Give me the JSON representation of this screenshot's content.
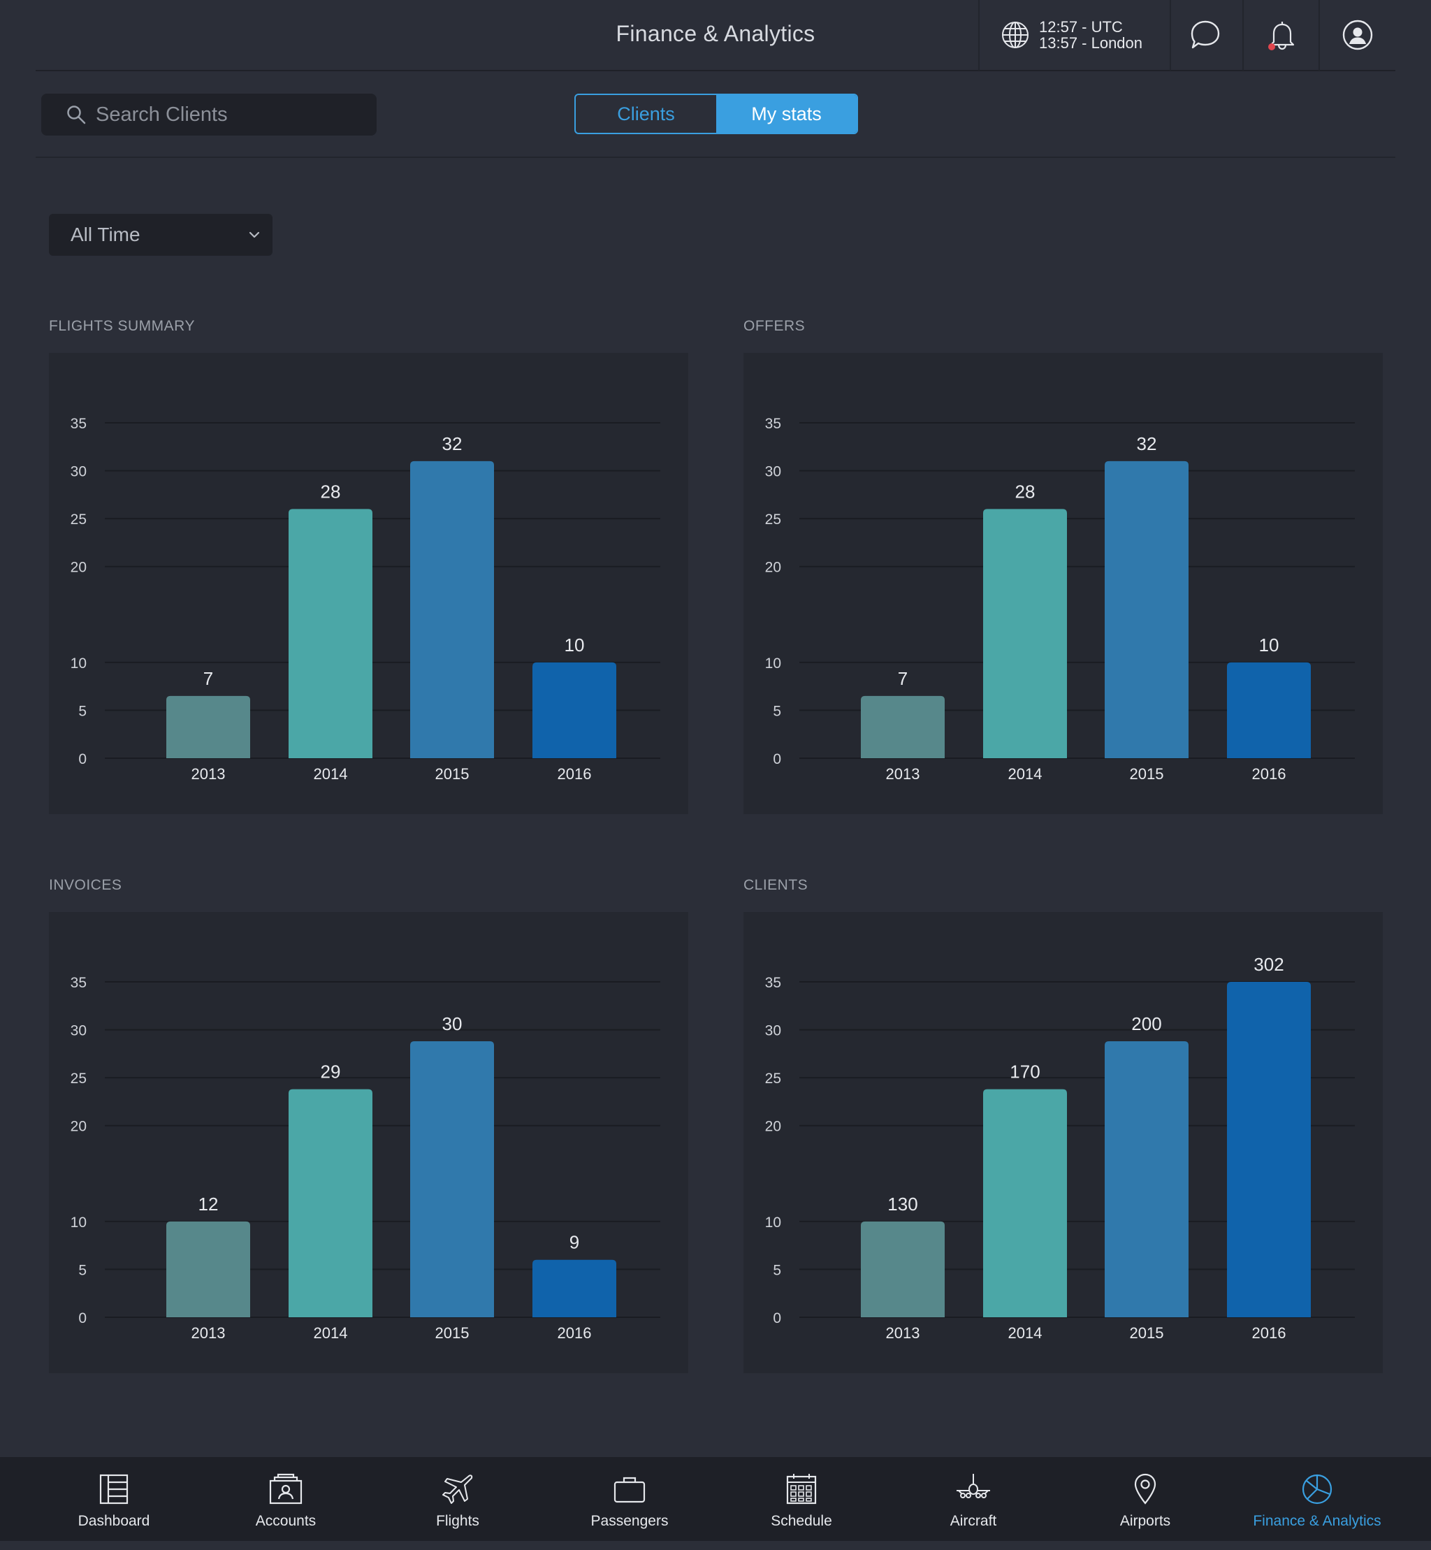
{
  "header": {
    "title": "Finance & Analytics",
    "time_utc": "12:57 - UTC",
    "time_local": "13:57 - London"
  },
  "search": {
    "placeholder": "Search Clients"
  },
  "tabs": [
    {
      "label": "Clients",
      "active": false
    },
    {
      "label": "My stats",
      "active": true
    }
  ],
  "filter": {
    "selected": "All Time"
  },
  "colors": {
    "accent": "#3a9fe0",
    "bar_2013": "#57888b",
    "bar_2014": "#4ba7a7",
    "bar_2015": "#3079ac",
    "bar_2016": "#1063ab",
    "notification_dot": "#e0464e"
  },
  "chart_data": [
    {
      "type": "bar",
      "title": "FLIGHTS SUMMARY",
      "categories": [
        "2013",
        "2014",
        "2015",
        "2016"
      ],
      "values": [
        7,
        28,
        32,
        10
      ],
      "bar_heights": [
        6.5,
        26,
        31,
        10
      ],
      "data_labels": [
        "7",
        "28",
        "32",
        "10"
      ],
      "yticks": [
        "0",
        "5",
        "10",
        "20",
        "25",
        "30",
        "35"
      ],
      "ylim": [
        0,
        35
      ],
      "grid": true
    },
    {
      "type": "bar",
      "title": "OFFERS",
      "categories": [
        "2013",
        "2014",
        "2015",
        "2016"
      ],
      "values": [
        7,
        28,
        32,
        10
      ],
      "bar_heights": [
        6.5,
        26,
        31,
        10
      ],
      "data_labels": [
        "7",
        "28",
        "32",
        "10"
      ],
      "yticks": [
        "0",
        "5",
        "10",
        "20",
        "25",
        "30",
        "35"
      ],
      "ylim": [
        0,
        35
      ],
      "grid": true
    },
    {
      "type": "bar",
      "title": "INVOICES",
      "categories": [
        "2013",
        "2014",
        "2015",
        "2016"
      ],
      "values": [
        12,
        29,
        30,
        9
      ],
      "bar_heights": [
        10,
        23.8,
        28.8,
        6
      ],
      "data_labels": [
        "12",
        "29",
        "30",
        "9"
      ],
      "yticks": [
        "0",
        "5",
        "10",
        "20",
        "25",
        "30",
        "35"
      ],
      "ylim": [
        0,
        35
      ],
      "grid": true
    },
    {
      "type": "bar",
      "title": "CLIENTS",
      "categories": [
        "2013",
        "2014",
        "2015",
        "2016"
      ],
      "values": [
        130,
        170,
        200,
        302
      ],
      "bar_heights": [
        10,
        23.8,
        28.8,
        35
      ],
      "data_labels": [
        "130",
        "170",
        "200",
        "302"
      ],
      "yticks": [
        "0",
        "5",
        "10",
        "20",
        "25",
        "30",
        "35"
      ],
      "ylim": [
        0,
        35
      ],
      "grid": true
    }
  ],
  "nav": {
    "items": [
      {
        "label": "Dashboard",
        "icon": "dashboard-icon",
        "active": false
      },
      {
        "label": "Accounts",
        "icon": "accounts-icon",
        "active": false
      },
      {
        "label": "Flights",
        "icon": "plane-icon",
        "active": false
      },
      {
        "label": "Passengers",
        "icon": "briefcase-icon",
        "active": false
      },
      {
        "label": "Schedule",
        "icon": "calendar-icon",
        "active": false
      },
      {
        "label": "Aircraft",
        "icon": "aircraft-icon",
        "active": false
      },
      {
        "label": "Airports",
        "icon": "map-pin-icon",
        "active": false
      },
      {
        "label": "Finance & Analytics",
        "icon": "pie-chart-icon",
        "active": true
      }
    ]
  }
}
